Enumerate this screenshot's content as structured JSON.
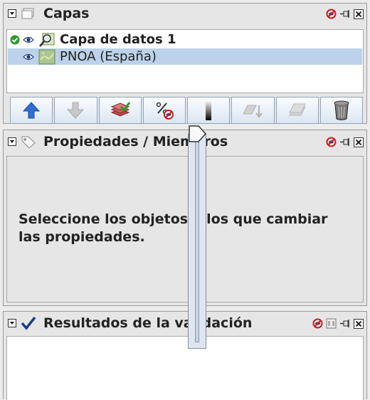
{
  "layers_panel": {
    "title": "Capas",
    "layers": [
      {
        "name": "Capa de datos 1",
        "bold": true,
        "visible": true,
        "checked": true,
        "selected": false,
        "icon": "data-layer-icon"
      },
      {
        "name": "PNOA (España)",
        "bold": false,
        "visible": true,
        "checked": false,
        "selected": true,
        "icon": "map-layer-icon"
      }
    ],
    "toolbar": [
      {
        "name": "move-layer-up-button",
        "icon": "arrow-up-icon",
        "enabled": true
      },
      {
        "name": "move-layer-down-button",
        "icon": "arrow-down-icon",
        "enabled": false
      },
      {
        "name": "validate-layers-button",
        "icon": "stack-check-icon",
        "enabled": true
      },
      {
        "name": "visibility-range-button",
        "icon": "eye-percent-icon",
        "enabled": true
      },
      {
        "name": "opacity-button",
        "icon": "opacity-gradient-icon",
        "enabled": true
      },
      {
        "name": "merge-down-button",
        "icon": "merge-down-icon",
        "enabled": false
      },
      {
        "name": "flatten-layers-button",
        "icon": "layers-icon",
        "enabled": false
      },
      {
        "name": "delete-layer-button",
        "icon": "trash-icon",
        "enabled": true
      }
    ]
  },
  "properties_panel": {
    "title": "Propiedades / Miembros",
    "message_line1": "Seleccione los objetos a los que cambiar",
    "message_line2": "las propiedades."
  },
  "validation_panel": {
    "title": "Resultados de la validación"
  },
  "opacity_slider": {
    "value": 1.0
  },
  "colors": {
    "accent": "#2e6fcf",
    "selection": "#bcd2ea",
    "panel_bg": "#e6e6e6"
  }
}
